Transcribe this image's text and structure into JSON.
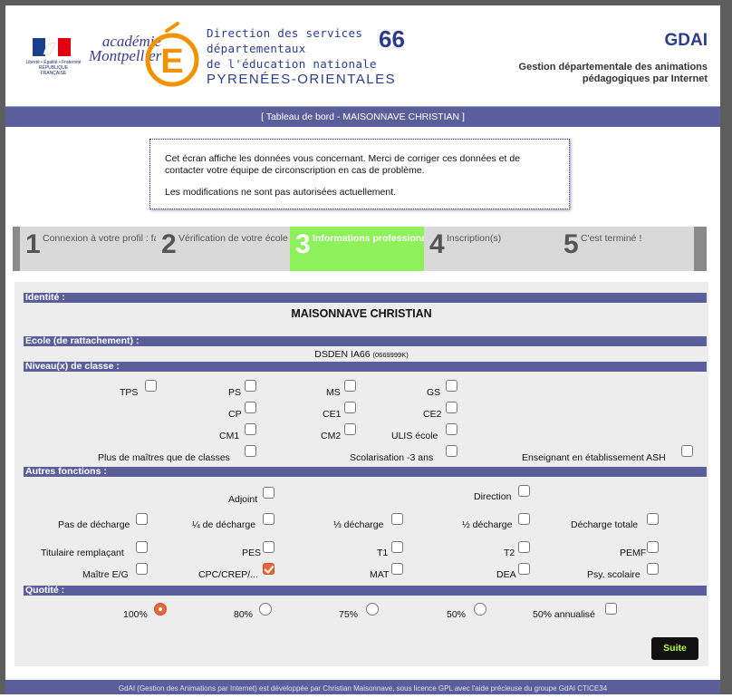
{
  "header": {
    "rf_logo_text": "Liberté • Égalité • Fraternité RÉPUBLIQUE FRANÇAISE",
    "academie": "académie",
    "academie_city": "Montpellier",
    "direction_lines": [
      "Direction des services",
      "départementaux",
      "de l'éducation nationale"
    ],
    "department_name": "PYRENÉES-ORIENTALES",
    "department_number": "66",
    "app_title": "GDAI",
    "app_subtitle": "Gestion départementale des animations pédagogiques par Internet"
  },
  "titlebar": "[ Tableau de bord - MAISONNAVE CHRISTIAN ]",
  "notice": {
    "line1": "Cet écran affiche les données vous concernant. Merci de corriger ces données et de contacter votre équipe de circonscription en cas de problème.",
    "line2": "Les modifications ne sont pas autorisées actuellement."
  },
  "steps": [
    {
      "num": "1",
      "label": "Connexion à votre profil : fait !"
    },
    {
      "num": "2",
      "label": "Vérification de votre école"
    },
    {
      "num": "3",
      "label": "Informations professionnelles"
    },
    {
      "num": "4",
      "label": "Inscription(s)"
    },
    {
      "num": "5",
      "label": "C'est terminé !"
    }
  ],
  "identite": {
    "section": "Identité :",
    "name": "MAISONNAVE CHRISTIAN"
  },
  "ecole": {
    "section": "Ecole (de rattachement) :",
    "name": "DSDEN IA66",
    "code": "(0669999K)"
  },
  "niveaux": {
    "section": "Niveau(x) de classe :",
    "items": [
      "TPS",
      "PS",
      "MS",
      "GS",
      "CP",
      "CE1",
      "CE2",
      "CM1",
      "CM2",
      "ULIS école",
      "Plus de maîtres que de classes",
      "Scolarisation -3 ans",
      "Enseignant en établissement ASH"
    ]
  },
  "fonctions": {
    "section": "Autres fonctions :",
    "items": [
      "Adjoint",
      "Direction",
      "Pas de décharge",
      "¼ de décharge",
      "⅓ décharge",
      "½ décharge",
      "Décharge totale",
      "Titulaire remplaçant",
      "PES",
      "T1",
      "T2",
      "PEMF",
      "Maître E/G",
      "CPC/CREP/...",
      "MAT",
      "DEA",
      "Psy. scolaire"
    ],
    "checked": "CPC/CREP/..."
  },
  "quotite": {
    "section": "Quotité :",
    "items": [
      "100%",
      "80%",
      "75%",
      "50%",
      "50% annualisé"
    ],
    "selected": "100%"
  },
  "buttons": {
    "suite": "Suite"
  },
  "footer": "GdAI (Gestion des Animations par Internet) est développée par Christian Maisonnave, sous licence GPL avec l'aide précieuse du groupe GdAI CTICE34"
}
